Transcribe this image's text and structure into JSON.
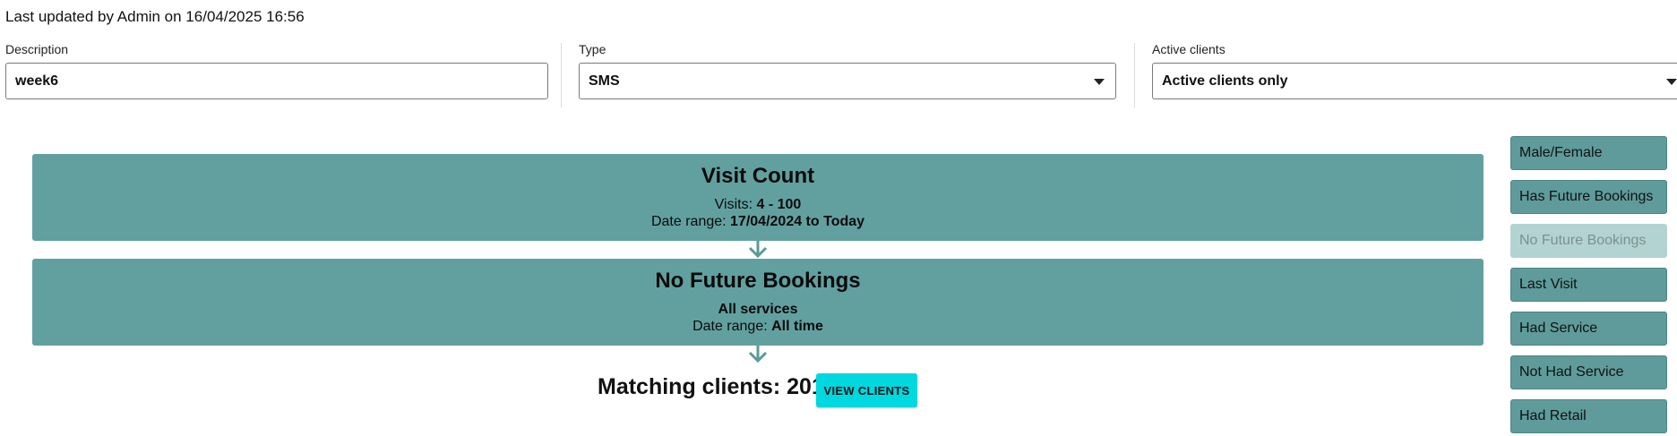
{
  "header": {
    "last_updated": "Last updated by Admin on 16/04/2025 16:56"
  },
  "fields": {
    "description": {
      "label": "Description",
      "value": "week6"
    },
    "type": {
      "label": "Type",
      "value": "SMS"
    },
    "active_clients": {
      "label": "Active clients",
      "value": "Active clients only"
    }
  },
  "steps": [
    {
      "title": "Visit Count",
      "line1_label": "Visits: ",
      "line1_value": "4 - 100",
      "line2_label": "Date range: ",
      "line2_value": "17/04/2024 to Today"
    },
    {
      "title": "No Future Bookings",
      "line1_value": "All services",
      "line2_label": "Date range: ",
      "line2_value": "All time"
    }
  ],
  "result": {
    "matching_text": "Matching clients: 201",
    "view_button": "VIEW CLIENTS"
  },
  "sidebar": {
    "buttons": [
      {
        "label": "Male/Female",
        "disabled": false
      },
      {
        "label": "Has Future Bookings",
        "disabled": false
      },
      {
        "label": "No Future Bookings",
        "disabled": true
      },
      {
        "label": "Last Visit",
        "disabled": false
      },
      {
        "label": "Had Service",
        "disabled": false
      },
      {
        "label": "Not Had Service",
        "disabled": false
      },
      {
        "label": "Had Retail",
        "disabled": false
      }
    ]
  },
  "colors": {
    "card_teal": "#62a0a0",
    "button_teal": "#5f9b9b",
    "button_disabled": "#b3d3d3",
    "view_button_cyan": "#00d8e0"
  }
}
